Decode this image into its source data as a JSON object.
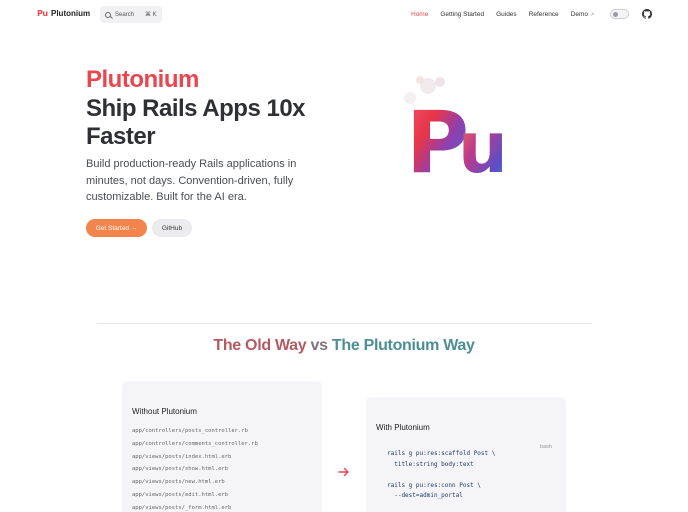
{
  "nav": {
    "brand": "Plutonium",
    "brand_logo_text": "Pu",
    "search_placeholder": "Search",
    "search_shortcut": "⌘ K",
    "links": [
      {
        "label": "Home",
        "active": true
      },
      {
        "label": "Getting Started",
        "active": false
      },
      {
        "label": "Guides",
        "active": false
      },
      {
        "label": "Reference",
        "active": false
      },
      {
        "label": "Demo",
        "active": false,
        "external": true
      }
    ],
    "external_glyph": "↗"
  },
  "hero": {
    "title_accent": "Plutonium",
    "title_main": "Ship Rails Apps 10x Faster",
    "subtitle": "Build production-ready Rails applications in minutes, not days. Convention-driven, fully customizable. Built for the AI era.",
    "primary_button": "Get Started →",
    "secondary_button": "GitHub",
    "art_text": "Pu"
  },
  "compare": {
    "title_old": "The Old Way",
    "title_vs": " vs ",
    "title_new": "The Plutonium Way",
    "left": {
      "title": "Without Plutonium",
      "files": [
        "app/controllers/posts_controller.rb",
        "app/controllers/comments_controller.rb",
        "app/views/posts/index.html.erb",
        "app/views/posts/show.html.erb",
        "app/views/posts/new.html.erb",
        "app/views/posts/edit.html.erb",
        "app/views/posts/_form.html.erb"
      ]
    },
    "right": {
      "title": "With Plutonium",
      "lang": "bash",
      "code": [
        "rails g pu:res:scaffold Post \\",
        "  title:string body:text",
        "",
        "rails g pu:res:conn Post \\",
        "  --dest=admin_portal"
      ]
    }
  },
  "colors": {
    "accent": "#e8474f",
    "primary_button": "#f2844c",
    "active_link": "#e24b4b",
    "teal": "#4c8f94"
  }
}
